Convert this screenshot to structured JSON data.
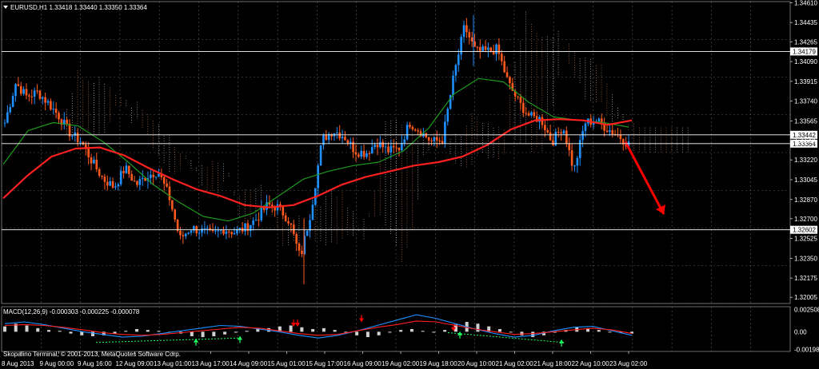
{
  "header": {
    "symbol_line": "EURUSD,H1  1.33418 1.33440 1.33350 1.33364",
    "macd_line": "MACD(12,26,9) -0.000303 -0.000225 -0.000078",
    "footer": "Skopalino Terminal, © 2001-2013, MetaQuotes Software Corp."
  },
  "colors": {
    "background": "#000000",
    "grid": "#5a5a5a",
    "bull": "#1e90ff",
    "bear": "#ff5a1e",
    "ma_red": "#ff2020",
    "ma_green": "#1e9a1e",
    "cloud_a": "#f4a070",
    "cloud_b": "#ffffff",
    "arrow_red": "#ff0000",
    "arrow_green": "#20ff60",
    "hline": "#ffffff"
  },
  "chart_data": [
    {
      "type": "candlestick",
      "title": "EURUSD,H1",
      "ylim": [
        1.3195,
        1.3462
      ],
      "price_ticks": [
        "1.34610",
        "1.34435",
        "1.34265",
        "1.34090",
        "1.33915",
        "1.33740",
        "1.33565",
        "1.33395",
        "1.33220",
        "1.33045",
        "1.32870",
        "1.32700",
        "1.32525",
        "1.32350",
        "1.32175",
        "1.32005"
      ],
      "horizontal_levels": [
        {
          "label": "1.34179",
          "value": 1.34179
        },
        {
          "label": "1.33442",
          "value": 1.33442
        },
        {
          "label": "1.33364",
          "value": 1.33364
        },
        {
          "label": "1.32602",
          "value": 1.32602
        }
      ],
      "x_labels": [
        "8 Aug 2013",
        "9 Aug 00:00",
        "9 Aug 16:00",
        "12 Aug 09:00",
        "13 Aug 01:00",
        "13 Aug 17:00",
        "14 Aug 09:00",
        "15 Aug 01:00",
        "15 Aug 17:00",
        "16 Aug 09:00",
        "19 Aug 02:00",
        "19 Aug 18:00",
        "20 Aug 10:00",
        "21 Aug 02:00",
        "21 Aug 18:00",
        "22 Aug 10:00",
        "23 Aug 02:00"
      ],
      "close_path": [
        1.3355,
        1.339,
        1.3378,
        1.3382,
        1.3372,
        1.336,
        1.3345,
        1.3338,
        1.332,
        1.3305,
        1.3298,
        1.3315,
        1.33,
        1.3308,
        1.3312,
        1.329,
        1.3252,
        1.3262,
        1.3259,
        1.3256,
        1.3261,
        1.3258,
        1.3262,
        1.327,
        1.3282,
        1.328,
        1.3268,
        1.3235,
        1.3278,
        1.334,
        1.3348,
        1.3343,
        1.333,
        1.3328,
        1.3338,
        1.333,
        1.3332,
        1.3355,
        1.3347,
        1.3338,
        1.334,
        1.3395,
        1.344,
        1.3418,
        1.3418,
        1.342,
        1.339,
        1.3372,
        1.336,
        1.3358,
        1.3338,
        1.3352,
        1.3312,
        1.3355,
        1.3357,
        1.335,
        1.3344,
        1.3336
      ],
      "ma_red": [
        1.3288,
        1.3308,
        1.3325,
        1.3332,
        1.3333,
        1.3326,
        1.3315,
        1.3305,
        1.3296,
        1.329,
        1.3282,
        1.328,
        1.3282,
        1.329,
        1.33,
        1.3307,
        1.3312,
        1.3317,
        1.332,
        1.3325,
        1.3335,
        1.3349,
        1.3357,
        1.3358,
        1.3357,
        1.3353,
        1.3357
      ],
      "ma_green": [
        1.3318,
        1.3348,
        1.3355,
        1.3352,
        1.3338,
        1.332,
        1.33,
        1.3285,
        1.3272,
        1.3268,
        1.3275,
        1.329,
        1.3305,
        1.3312,
        1.3317,
        1.332,
        1.333,
        1.335,
        1.338,
        1.3394,
        1.3391,
        1.3373,
        1.336,
        1.3357,
        1.3355,
        1.3351
      ],
      "forecast_arrow": {
        "from": 1.3338,
        "to": 1.3274
      },
      "macd": {
        "ticks": [
          "0.002508",
          "0.00",
          "-0.001986"
        ],
        "ylim": [
          -0.0022,
          0.0028
        ],
        "histogram": [
          0.0006,
          0.0009,
          0.0007,
          0.0004,
          0.0002,
          0.0001,
          -0.0002,
          -0.0004,
          -0.0005,
          -0.0004,
          -0.0002,
          0.0001,
          0.0003,
          0.0002,
          0.0001,
          0.0,
          -0.0002,
          -0.0005,
          -0.0006,
          -0.0005,
          -0.0003,
          -0.0001,
          0.0001,
          0.0003,
          0.0004,
          0.0006,
          0.0007,
          0.0005,
          0.0003,
          0.0004,
          0.0002,
          0.0,
          -0.0004,
          -0.0006,
          -0.0004,
          -0.0001,
          0.0002,
          0.0003,
          0.0001,
          -0.0001,
          0.0002,
          0.0008,
          0.0011,
          0.0009,
          0.0006,
          0.0003,
          0.0,
          -0.0004,
          -0.0006,
          -0.0004,
          -0.0001,
          0.0002,
          0.0005,
          0.0004,
          0.0002,
          0.0,
          -0.0001,
          -0.0002
        ],
        "signal": [
          0.0007,
          0.0008,
          0.0007,
          0.0005,
          0.0002,
          -0.0001,
          -0.0003,
          -0.0004,
          -0.0003,
          -0.0001,
          0.0001,
          0.0003,
          0.0005,
          0.0004,
          0.0001,
          -0.0002,
          -0.0004,
          -0.0003,
          0.0001,
          0.0005,
          0.0008,
          0.0012,
          0.0011,
          0.0007,
          0.0003,
          0.0,
          -0.0003,
          -0.0002,
          0.0,
          0.0002,
          0.0004,
          0.0002,
          -0.0002
        ],
        "main": [
          0.0009,
          0.0011,
          0.0008,
          0.0004,
          0.0,
          -0.0003,
          -0.0006,
          -0.0005,
          -0.0002,
          0.0001,
          0.0004,
          0.0007,
          0.0006,
          0.0003,
          0.0,
          -0.0004,
          -0.0007,
          -0.0004,
          0.0001,
          0.0007,
          0.0013,
          0.0019,
          0.0015,
          0.0009,
          0.0003,
          -0.0002,
          -0.0006,
          -0.0004,
          0.0001,
          0.0005,
          0.0006,
          0.0001,
          -0.0004
        ]
      }
    }
  ]
}
